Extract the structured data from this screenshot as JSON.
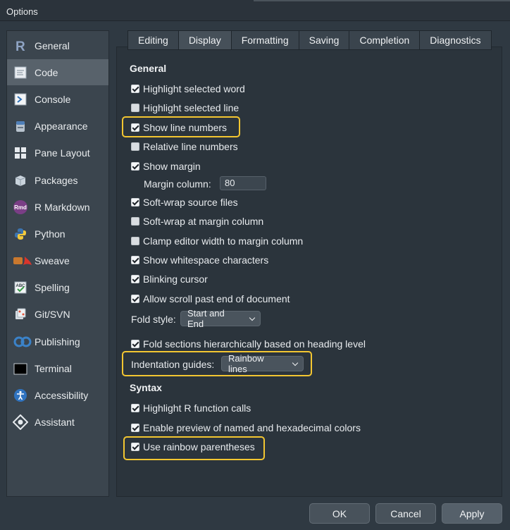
{
  "window": {
    "title": "Options"
  },
  "sidebar": {
    "items": [
      {
        "label": "General",
        "icon": "r-logo-icon"
      },
      {
        "label": "Code",
        "icon": "code-icon",
        "selected": true
      },
      {
        "label": "Console",
        "icon": "console-icon"
      },
      {
        "label": "Appearance",
        "icon": "appearance-icon"
      },
      {
        "label": "Pane Layout",
        "icon": "pane-layout-icon"
      },
      {
        "label": "Packages",
        "icon": "packages-icon"
      },
      {
        "label": "R Markdown",
        "icon": "rmd-icon",
        "icon_text": "Rmd"
      },
      {
        "label": "Python",
        "icon": "python-icon"
      },
      {
        "label": "Sweave",
        "icon": "sweave-icon"
      },
      {
        "label": "Spelling",
        "icon": "spelling-icon",
        "icon_text": "ABC"
      },
      {
        "label": "Git/SVN",
        "icon": "git-icon"
      },
      {
        "label": "Publishing",
        "icon": "publishing-icon"
      },
      {
        "label": "Terminal",
        "icon": "terminal-icon"
      },
      {
        "label": "Accessibility",
        "icon": "accessibility-icon"
      },
      {
        "label": "Assistant",
        "icon": "assistant-icon"
      }
    ]
  },
  "tabs": [
    "Editing",
    "Display",
    "Formatting",
    "Saving",
    "Completion",
    "Diagnostics"
  ],
  "active_tab": "Display",
  "general": {
    "title": "General",
    "options": [
      {
        "label": "Highlight selected word",
        "checked": true
      },
      {
        "label": "Highlight selected line",
        "checked": false
      },
      {
        "label": "Show line numbers",
        "checked": true
      },
      {
        "label": "Relative line numbers",
        "checked": false
      },
      {
        "label": "Show margin",
        "checked": true
      }
    ],
    "margin_column_label": "Margin column:",
    "margin_column_value": "80",
    "options2": [
      {
        "label": "Soft-wrap source files",
        "checked": true
      },
      {
        "label": "Soft-wrap at margin column",
        "checked": false
      },
      {
        "label": "Clamp editor width to margin column",
        "checked": false
      },
      {
        "label": "Show whitespace characters",
        "checked": true
      },
      {
        "label": "Blinking cursor",
        "checked": true
      },
      {
        "label": "Allow scroll past end of document",
        "checked": true
      }
    ],
    "fold_style_label": "Fold style:",
    "fold_style_value": "Start and End",
    "fold_hier_label": "Fold sections hierarchically based on heading level",
    "fold_hier_checked": true,
    "indent_label": "Indentation guides:",
    "indent_value": "Rainbow lines"
  },
  "syntax": {
    "title": "Syntax",
    "options": [
      {
        "label": "Highlight R function calls",
        "checked": true
      },
      {
        "label": "Enable preview of named and hexadecimal colors",
        "checked": true
      },
      {
        "label": "Use rainbow parentheses",
        "checked": true
      }
    ]
  },
  "buttons": {
    "ok": "OK",
    "cancel": "Cancel",
    "apply": "Apply"
  },
  "colors": {
    "highlight": "#f3c631",
    "panel": "#2b343c",
    "sidebar": "#3b454e"
  }
}
